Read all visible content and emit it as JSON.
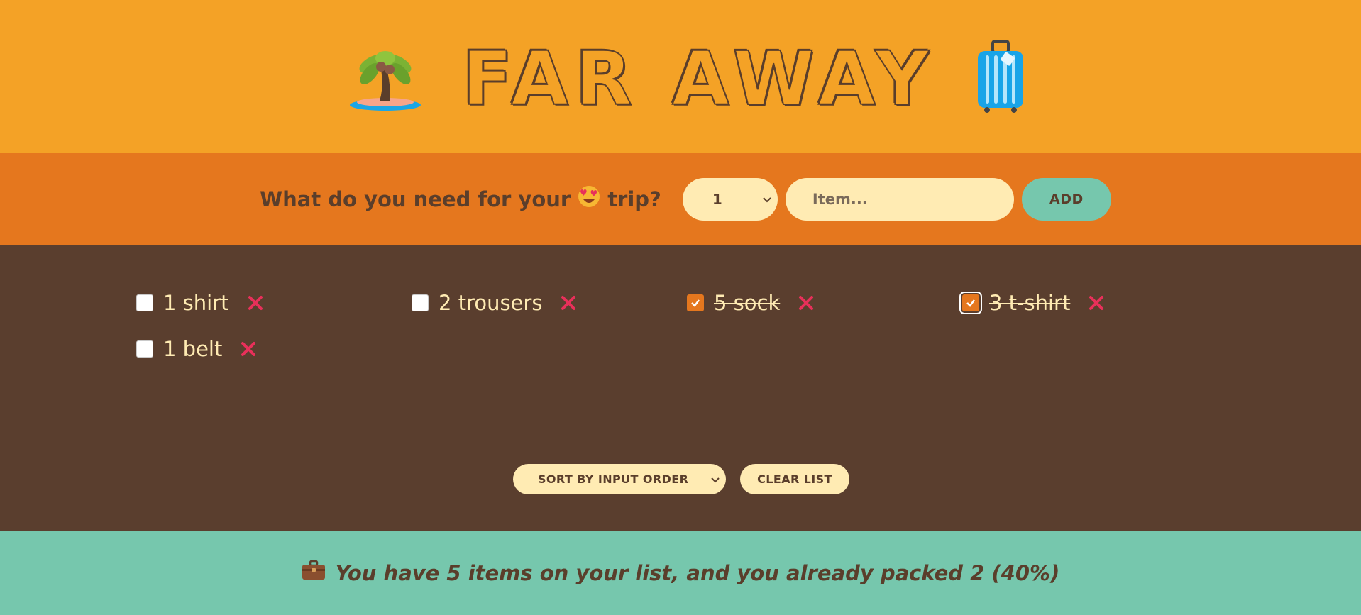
{
  "header": {
    "title": "FAR AWAY",
    "left_icon": "palm-island-icon",
    "right_icon": "luggage-icon"
  },
  "form": {
    "question_prefix": "What do you need for your",
    "question_suffix": "trip?",
    "emoji_icon": "heart-eyes-emoji-icon",
    "quantity_value": "1",
    "item_placeholder": "Item...",
    "add_label": "ADD"
  },
  "items": [
    {
      "label": "1 shirt",
      "packed": false
    },
    {
      "label": "2 trousers",
      "packed": false
    },
    {
      "label": "5 sock",
      "packed": true
    },
    {
      "label": "3 t-shirt",
      "packed": true
    },
    {
      "label": "1 belt",
      "packed": false
    }
  ],
  "actions": {
    "sort_value": "SORT BY INPUT ORDER",
    "clear_label": "CLEAR LIST"
  },
  "stats": {
    "icon": "briefcase-icon",
    "text": "You have 5 items on your list, and you already packed 2 (40%)"
  },
  "colors": {
    "header_bg": "#f4a226",
    "form_bg": "#e5771e",
    "list_bg": "#5a3e2e",
    "stats_bg": "#76c7ad",
    "cream": "#ffebb3",
    "delete_red": "#e8305a"
  }
}
